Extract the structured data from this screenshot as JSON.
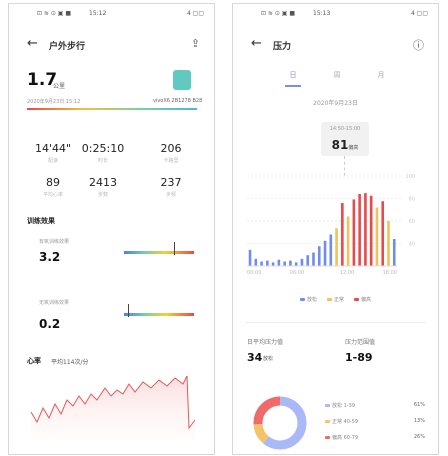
{
  "left": {
    "status": {
      "left": "⊡ ≋ ⊙ ▣ ■",
      "time": "15:12",
      "right": "4 ▢▢"
    },
    "header": {
      "title": "户外步行"
    },
    "distance": {
      "value": "1.7",
      "unit": "公里"
    },
    "date_text": "2020年9月23日 15:12",
    "device": "vivoX6 2B1278 B28",
    "stats": [
      {
        "value": "14'44\"",
        "label": "配速"
      },
      {
        "value": "0:25:10",
        "label": "时长"
      },
      {
        "value": "206",
        "label": "卡路里"
      },
      {
        "value": "89",
        "label": "平均心率"
      },
      {
        "value": "2413",
        "label": "步数"
      },
      {
        "value": "237",
        "label": "步频"
      }
    ],
    "training": {
      "title": "训练效果",
      "items": [
        {
          "label": "有氧训练效果",
          "value": "3.2",
          "level": 0.72
        },
        {
          "label": "无氧训练效果",
          "value": "0.2",
          "level": 0.05
        }
      ]
    },
    "heart": {
      "title": "心率",
      "avg": "平均114次/分"
    }
  },
  "right": {
    "status": {
      "left": "⊡ ≋ ⊙ ▣ ■",
      "time": "15:13",
      "right": "4 ▢▢"
    },
    "header": {
      "title": "压力"
    },
    "tabs": [
      "日",
      "周",
      "月"
    ],
    "date": "2020年9月23日",
    "tooltip": {
      "time": "14:50-15:00",
      "value": "81",
      "unit": "偏高"
    },
    "chart_data": {
      "type": "bar",
      "ylim": [
        0,
        100
      ],
      "values": [
        {
          "v": 18,
          "c": "blue"
        },
        {
          "v": 8,
          "c": "blue"
        },
        {
          "v": 5,
          "c": "blue"
        },
        {
          "v": 6,
          "c": "blue"
        },
        {
          "v": 4,
          "c": "blue"
        },
        {
          "v": 7,
          "c": "blue"
        },
        {
          "v": 5,
          "c": "blue"
        },
        {
          "v": 6,
          "c": "blue"
        },
        {
          "v": 4,
          "c": "blue"
        },
        {
          "v": 8,
          "c": "blue"
        },
        {
          "v": 12,
          "c": "blue"
        },
        {
          "v": 15,
          "c": "blue"
        },
        {
          "v": 22,
          "c": "blue"
        },
        {
          "v": 28,
          "c": "blue"
        },
        {
          "v": 35,
          "c": "blue"
        },
        {
          "v": 42,
          "c": "yellow"
        },
        {
          "v": 70,
          "c": "red"
        },
        {
          "v": 55,
          "c": "yellow"
        },
        {
          "v": 74,
          "c": "red"
        },
        {
          "v": 80,
          "c": "red"
        },
        {
          "v": 81,
          "c": "red"
        },
        {
          "v": 78,
          "c": "red"
        },
        {
          "v": 65,
          "c": "yellow"
        },
        {
          "v": 72,
          "c": "red"
        },
        {
          "v": 50,
          "c": "yellow"
        },
        {
          "v": 30,
          "c": "blue"
        }
      ],
      "x_ticks": [
        "00:00",
        "06:00",
        "12:00",
        "18:00"
      ],
      "y_ticks": [
        "100",
        "80",
        "60",
        "40"
      ],
      "legend": [
        "放松",
        "正常",
        "偏高"
      ]
    },
    "summary": [
      {
        "label": "日平均压力值",
        "value": "34",
        "unit": "放松"
      },
      {
        "label": "压力范围值",
        "value": "1-89",
        "unit": ""
      }
    ],
    "pie": {
      "items": [
        {
          "label": "放松 1-39",
          "pct": "61%",
          "frac": 0.61,
          "color": "#a9b8f6"
        },
        {
          "label": "正常 40-59",
          "pct": "13%",
          "frac": 0.13,
          "color": "#f4c469"
        },
        {
          "label": "偏高 60-79",
          "pct": "26%",
          "frac": 0.26,
          "color": "#f06a6a"
        }
      ]
    },
    "colors": {
      "blue": "#6f8cf0",
      "yellow": "#f0c25a",
      "red": "#e9484d"
    }
  }
}
